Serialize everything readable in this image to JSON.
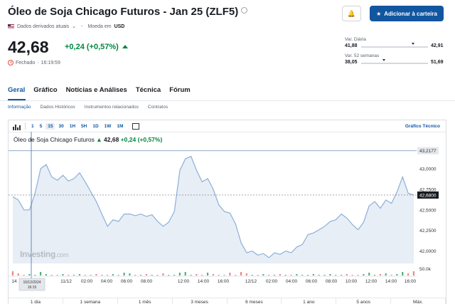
{
  "header": {
    "title": "Óleo de Soja Chicago Futuros - Jan 25 (ZLF5)",
    "data_type": "Dados derivados atuais",
    "currency_label": "Moeda em",
    "currency": "USD",
    "add_button": "Adicionar à carteira"
  },
  "quote": {
    "price": "42,68",
    "change": "+0,24 (+0,57%)",
    "status": "Fechado",
    "time": "16:19:59"
  },
  "ranges": {
    "daily": {
      "label": "Var. Diária",
      "low": "41,88",
      "high": "42,91",
      "position": 0.78
    },
    "week52": {
      "label": "Var. 52 semanas",
      "low": "38,05",
      "high": "51,69",
      "position": 0.34
    }
  },
  "tabs": [
    "Geral",
    "Gráfico",
    "Notícias e Análises",
    "Técnica",
    "Fórum"
  ],
  "subtabs": [
    "Informação",
    "Dados Históricos",
    "Instrumentos relacionados",
    "Contratos"
  ],
  "chart_toolbar": {
    "intervals": [
      "1",
      "5",
      "15",
      "30",
      "1H",
      "5H",
      "1D",
      "1W",
      "1M"
    ],
    "selected": "15",
    "right_link": "Gráfico Técnico"
  },
  "chart_legend": {
    "name": "Óleo de Soja Chicago Futuros",
    "price": "42,68",
    "change": "+0,24 (+0,57%)"
  },
  "watermark": {
    "brand": "Investing",
    "suffix": ".com"
  },
  "colors": {
    "accent": "#1256a0",
    "up": "#008542",
    "down": "#e6483d"
  },
  "chart_data": {
    "type": "area",
    "y_ticks": [
      "43,0000",
      "42,7500",
      "42,5000",
      "42,2500",
      "42,0000"
    ],
    "y_highlight": [
      "43,2177",
      "42,6800"
    ],
    "volume_label": "50.0k",
    "x_ticks": [
      "14",
      "11/12",
      "02:00",
      "04:00",
      "06:00",
      "08:00",
      "12:00",
      "14:00",
      "16:00",
      "12/12",
      "02:00",
      "04:00",
      "06:00",
      "08:00",
      "10:00",
      "12:00",
      "14:00",
      "16:00"
    ],
    "cursor_label": "10/12/2024\n16:15",
    "series": [
      42.66,
      42.62,
      42.5,
      42.5,
      42.7,
      43.0,
      43.05,
      42.9,
      42.86,
      42.92,
      42.85,
      42.88,
      42.95,
      42.84,
      42.72,
      42.6,
      42.45,
      42.3,
      42.38,
      42.36,
      42.45,
      42.45,
      42.43,
      42.45,
      42.42,
      42.44,
      42.36,
      42.3,
      42.35,
      42.48,
      42.98,
      43.12,
      43.15,
      42.98,
      42.84,
      42.88,
      42.75,
      42.56,
      42.48,
      42.46,
      42.33,
      42.1,
      41.98,
      42.0,
      41.95,
      41.97,
      41.92,
      41.98,
      41.96,
      42.0,
      41.98,
      42.05,
      42.08,
      42.2,
      42.22,
      42.26,
      42.3,
      42.36,
      42.38,
      42.45,
      42.4,
      42.32,
      42.26,
      42.35,
      42.55,
      42.6,
      42.52,
      42.62,
      42.58,
      42.72,
      42.9,
      42.7,
      42.68
    ]
  },
  "bottom_ranges": [
    "1 dia",
    "1 semana",
    "1 mês",
    "3 meses",
    "6 meses",
    "1 ano",
    "5 anos",
    "Máx."
  ]
}
